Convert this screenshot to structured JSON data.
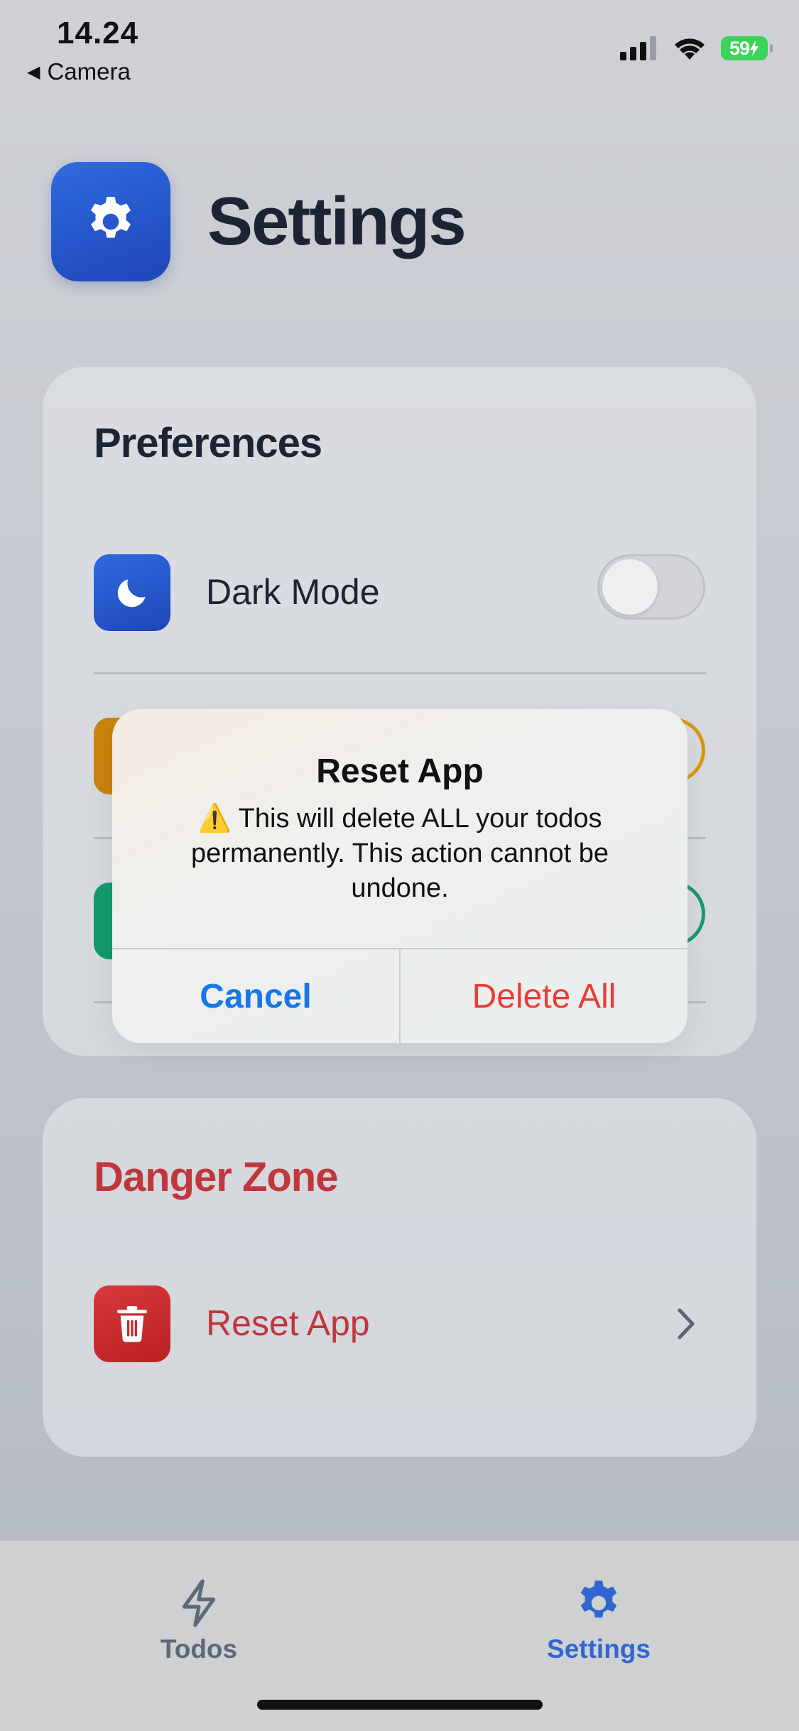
{
  "status_bar": {
    "time": "14.24",
    "back_label": "Camera",
    "battery_percent": "59",
    "icons": [
      "signal-icon",
      "wifi-icon",
      "battery-charging-icon"
    ]
  },
  "header": {
    "title": "Settings",
    "icon": "gear-icon",
    "accent_color": "#2756cc"
  },
  "preferences": {
    "title": "Preferences",
    "items": [
      {
        "label": "Dark Mode",
        "icon": "moon-icon",
        "icon_color": "#2756cc",
        "toggle_on": false
      }
    ]
  },
  "danger_zone": {
    "title": "Danger Zone",
    "items": [
      {
        "label": "Reset App",
        "icon": "trash-icon",
        "icon_color": "#c92a2d",
        "action": "chevron-right-icon"
      }
    ]
  },
  "dialog": {
    "title": "Reset App",
    "message_line1": "⚠️ This will delete ALL your todos",
    "message_line2": "permanently. This action cannot be",
    "message_line3": "undone.",
    "cancel_label": "Cancel",
    "confirm_label": "Delete All",
    "cancel_color": "#1877e8",
    "confirm_color": "#ec3b32"
  },
  "tabbar": {
    "tabs": [
      {
        "label": "Todos",
        "icon": "bolt-icon",
        "active": false
      },
      {
        "label": "Settings",
        "icon": "gear-icon",
        "active": true
      }
    ],
    "active_color": "#2f66cf",
    "inactive_color": "#5d6878"
  }
}
